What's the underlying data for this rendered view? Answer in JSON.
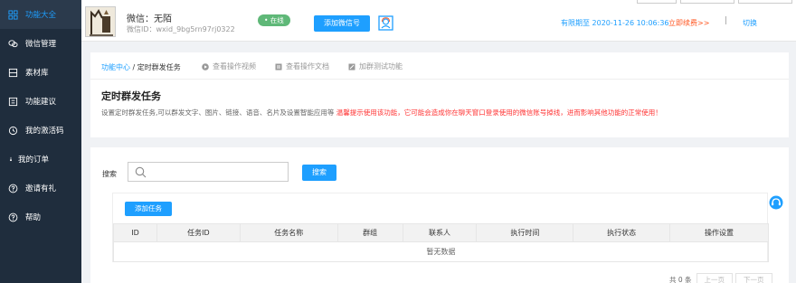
{
  "sidebar": {
    "items": [
      {
        "label": "功能大全",
        "icon": "grid-icon"
      },
      {
        "label": "微信管理",
        "icon": "wechat-icon"
      },
      {
        "label": "素材库",
        "icon": "folder-icon"
      },
      {
        "label": "功能建议",
        "icon": "document-icon"
      },
      {
        "label": "我的激活码",
        "icon": "clock-icon"
      },
      {
        "label": "我的订单",
        "icon": "bullet-icon"
      },
      {
        "label": "邀请有礼",
        "icon": "question-circle-icon"
      },
      {
        "label": "帮助",
        "icon": "question-circle-icon"
      }
    ]
  },
  "header": {
    "nickname": "微信：无陌",
    "wxid": "微信ID：wxid_9bg5rn97rj0322",
    "status": "• 在线",
    "add_button": "添加微信号",
    "expire": "有限期至 2020-11-26 10:06:36",
    "renew": "立即续费>>",
    "separator": "|",
    "switch": "切换"
  },
  "breadcrumb": {
    "home": "功能中心",
    "slash": " / ",
    "current": "定时群发任务",
    "video": "查看操作视频",
    "doc": "查看操作文档",
    "test": "加群测试功能"
  },
  "page": {
    "title": "定时群发任务",
    "desc": "设置定时群发任务,可以群发文字、图片、链接、语音、名片及设置智能应用等",
    "warning": "温馨提示使用该功能，它可能会造成你在聊天窗口登录使用的微信账号掉线，进而影响其他功能的正常使用！"
  },
  "search": {
    "label": "搜索",
    "placeholder": "",
    "button": "搜索"
  },
  "table": {
    "add_button": "添加任务",
    "columns": [
      "ID",
      "任务ID",
      "任务名称",
      "群组",
      "联系人",
      "执行时间",
      "执行状态",
      "操作设置"
    ],
    "empty_text": "暂无数据"
  },
  "pager": {
    "total": "共 0 条",
    "prev": "上一页",
    "next": "下一页"
  },
  "colors": {
    "accent": "#1e9fff",
    "sidebar_bg": "#1f2d3d",
    "online": "#5fb878",
    "warning": "#ff3333",
    "renew": "#ff5722"
  }
}
